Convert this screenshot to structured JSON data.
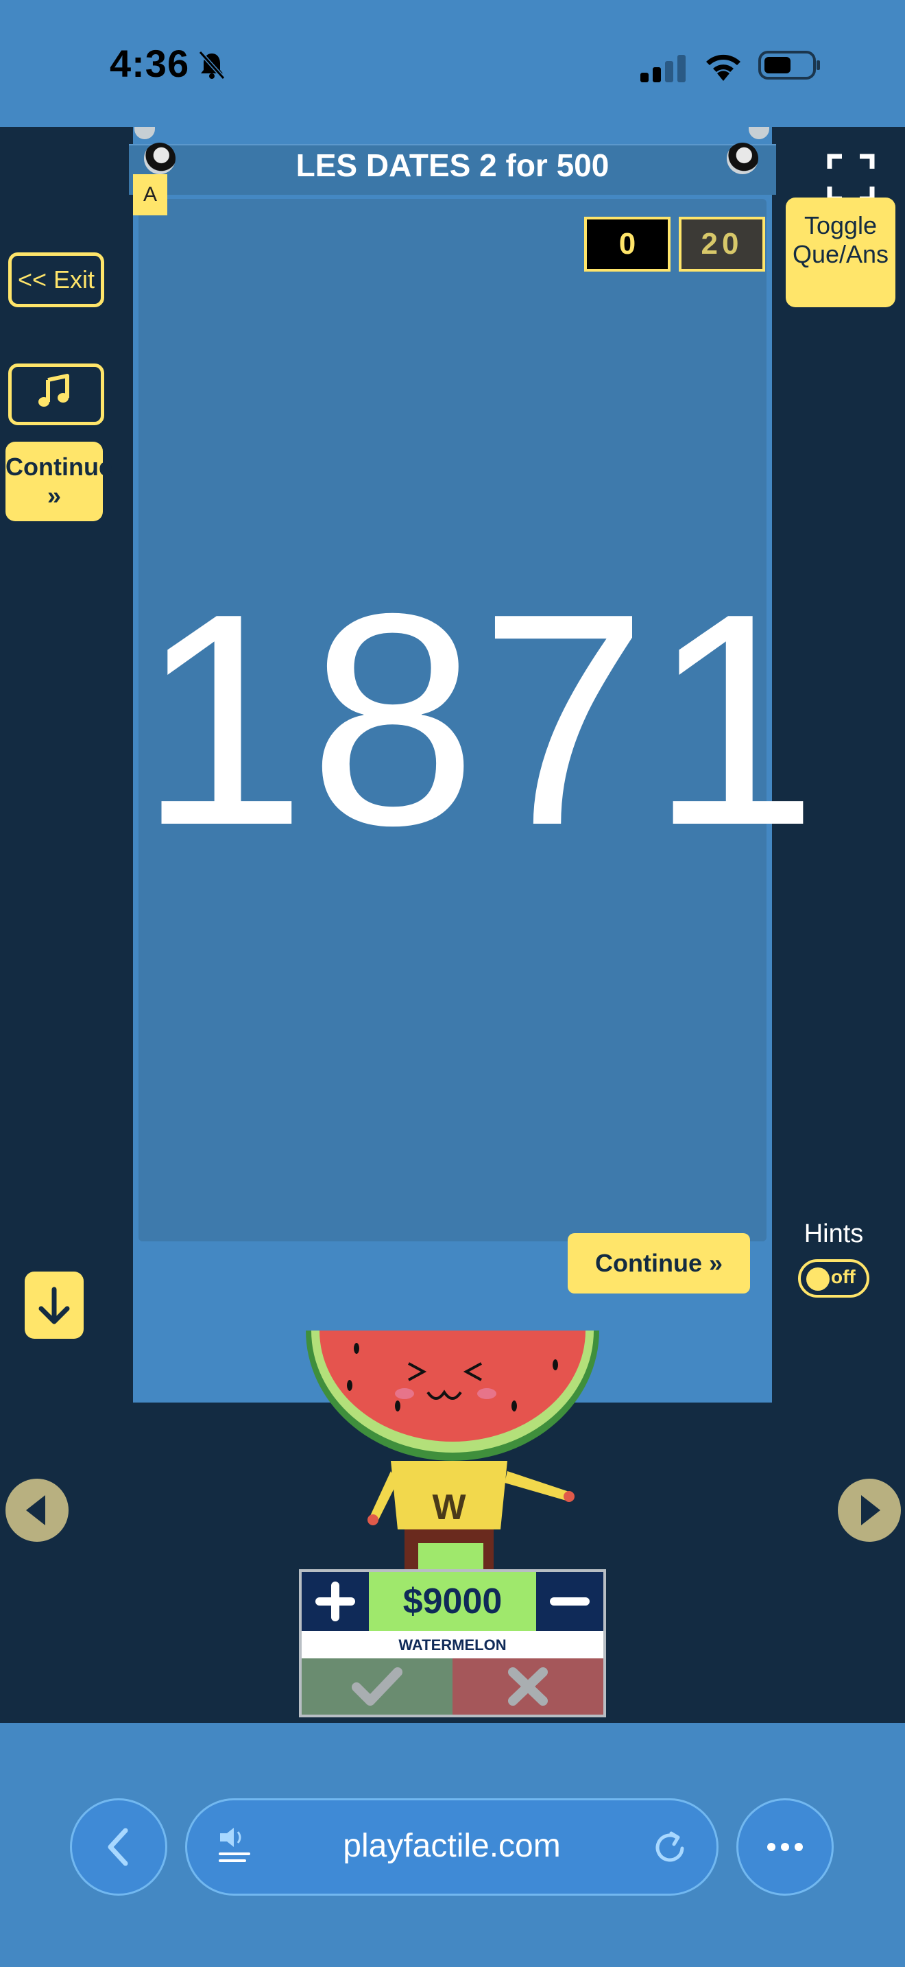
{
  "status_bar": {
    "time": "4:36"
  },
  "game": {
    "title": "LES DATES 2 for 500",
    "team_badge": "A",
    "scores": [
      "0",
      "20"
    ],
    "answer": "1871",
    "continue_label": "Continue »",
    "exit_label": "<< Exit",
    "continue_side_label": "Continue »",
    "toggle_label": "Toggle Que/Ans",
    "hints": {
      "label": "Hints",
      "state": "off"
    }
  },
  "player": {
    "score": "$9000",
    "name": "WATERMELON",
    "mascot_letter": "W"
  },
  "browser": {
    "url": "playfactile.com"
  },
  "colors": {
    "accent_yellow": "#ffe56a",
    "background_dark": "#132b42",
    "panel_blue": "#4488c3",
    "score_green": "#9fe86c"
  }
}
